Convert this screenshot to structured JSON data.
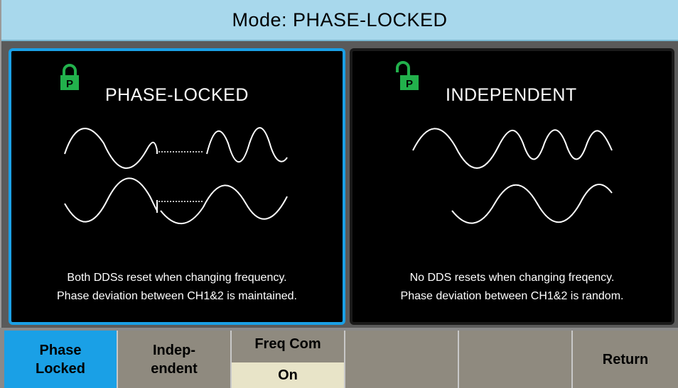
{
  "title": "Mode: PHASE-LOCKED",
  "panels": {
    "phase_locked": {
      "title": "PHASE-LOCKED",
      "desc_line1": "Both DDSs reset when changing frequency.",
      "desc_line2": "Phase deviation between CH1&2 is maintained."
    },
    "independent": {
      "title": "INDEPENDENT",
      "desc_line1": "No DDS resets when changing freqency.",
      "desc_line2": "Phase deviation between CH1&2 is random."
    }
  },
  "softkeys": {
    "phase_locked_line1": "Phase",
    "phase_locked_line2": "Locked",
    "independent_line1": "Indep-",
    "independent_line2": "endent",
    "freq_com_label": "Freq Com",
    "freq_com_value": "On",
    "return_label": "Return"
  },
  "colors": {
    "accent": "#1aa0e6",
    "title_bg": "#a8d8ec",
    "lock_green": "#22b14c"
  },
  "icons": {
    "locked": "padlock-closed-icon",
    "unlocked": "padlock-open-icon"
  }
}
